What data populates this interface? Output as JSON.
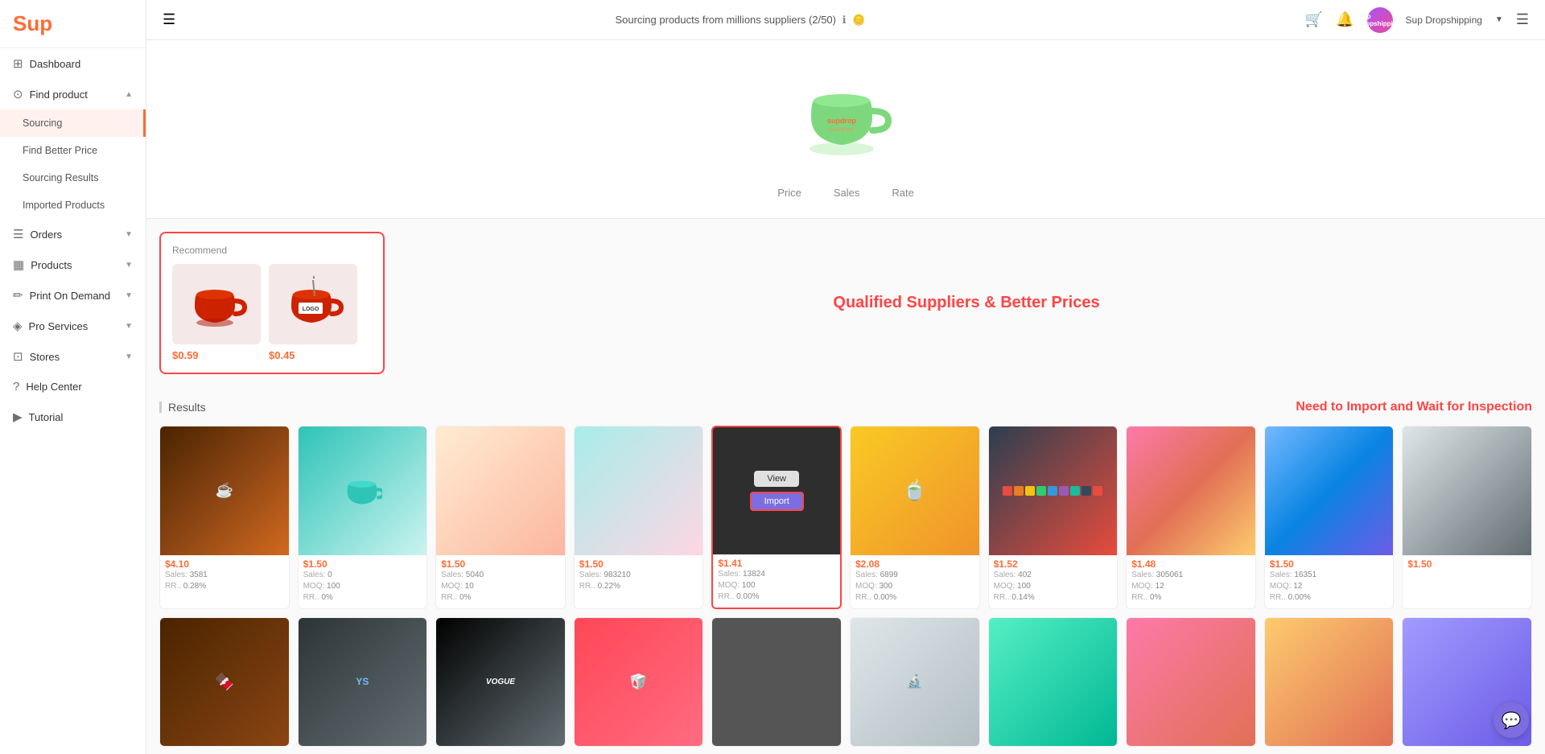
{
  "app": {
    "logo": "Sup",
    "user": "Sup Dropshipping"
  },
  "topbar": {
    "sourcing_info": "Sourcing products from millions suppliers (2/50)",
    "cart_icon": "cart",
    "bell_icon": "bell",
    "menu_icon": "menu",
    "user_avatar": "Sup"
  },
  "sidebar": {
    "items": [
      {
        "id": "dashboard",
        "label": "Dashboard",
        "icon": "⊞",
        "type": "top"
      },
      {
        "id": "find-product",
        "label": "Find product",
        "icon": "⊙",
        "type": "section",
        "expanded": true
      },
      {
        "id": "sourcing",
        "label": "Sourcing",
        "type": "sub",
        "active": true
      },
      {
        "id": "find-better-price",
        "label": "Find Better Price",
        "type": "sub"
      },
      {
        "id": "sourcing-results",
        "label": "Sourcing Results",
        "type": "sub"
      },
      {
        "id": "imported-products",
        "label": "Imported Products",
        "type": "sub"
      },
      {
        "id": "orders",
        "label": "Orders",
        "icon": "☰",
        "type": "section"
      },
      {
        "id": "products",
        "label": "Products",
        "icon": "▦",
        "type": "section"
      },
      {
        "id": "print-on-demand",
        "label": "Print On Demand",
        "icon": "✏",
        "type": "section"
      },
      {
        "id": "pro-services",
        "label": "Pro Services",
        "icon": "◈",
        "type": "section"
      },
      {
        "id": "stores",
        "label": "Stores",
        "icon": "⊡",
        "type": "section"
      },
      {
        "id": "help-center",
        "label": "Help Center",
        "icon": "?",
        "type": "top"
      },
      {
        "id": "tutorial",
        "label": "Tutorial",
        "icon": "▶",
        "type": "top"
      }
    ]
  },
  "hero": {
    "mug_label": "supdrop",
    "tabs": [
      "Price",
      "Sales",
      "Rate"
    ]
  },
  "recommend": {
    "label": "Recommend",
    "products": [
      {
        "price": "$0.59"
      },
      {
        "price": "$0.45"
      }
    ]
  },
  "qualified": {
    "text": "Qualified Suppliers & Better Prices"
  },
  "results": {
    "label": "Results",
    "need_import_text": "Need to Import and Wait for Inspection",
    "products": [
      {
        "price": "$4.10",
        "sales": "3581",
        "rr": "0.28%",
        "img_class": "img-choc"
      },
      {
        "price": "$1.50",
        "sales": "0",
        "moq": "100",
        "rr": "0%",
        "img_class": "img-mug-teal"
      },
      {
        "price": "$1.50",
        "sales": "5040",
        "moq": "10",
        "rr": "0%",
        "img_class": "img-sticker"
      },
      {
        "price": "$1.50",
        "sales": "983210",
        "moq": "",
        "rr": "0.22%",
        "img_class": "img-sticker2"
      },
      {
        "price": "$1.41",
        "sales": "13824",
        "moq": "100",
        "rr": "0.00%",
        "img_class": "img-dark",
        "highlighted": true
      },
      {
        "price": "$2.08",
        "sales": "6899",
        "moq": "300",
        "rr": "0.00%",
        "img_class": "img-mug-green"
      },
      {
        "price": "$1.52",
        "sales": "402",
        "moq": "100",
        "rr": "0.14%",
        "img_class": "img-mugs-color"
      },
      {
        "price": "$1.48",
        "sales": "305061",
        "moq": "12",
        "rr": "0%",
        "img_class": "img-sticker3"
      },
      {
        "price": "$1.50",
        "sales": "16351",
        "moq": "12",
        "rr": "0.00%",
        "img_class": "img-sticker4"
      }
    ],
    "products2": [
      {
        "price": "",
        "img_class": "img-choc2"
      },
      {
        "price": "",
        "img_class": "img-ys"
      },
      {
        "price": "",
        "img_class": "img-vogue"
      },
      {
        "price": "",
        "img_class": "img-cn"
      },
      {
        "price": "",
        "img_class": "img-dark2"
      },
      {
        "price": "",
        "img_class": "img-lab"
      }
    ]
  },
  "chat": {
    "icon": "💬"
  }
}
